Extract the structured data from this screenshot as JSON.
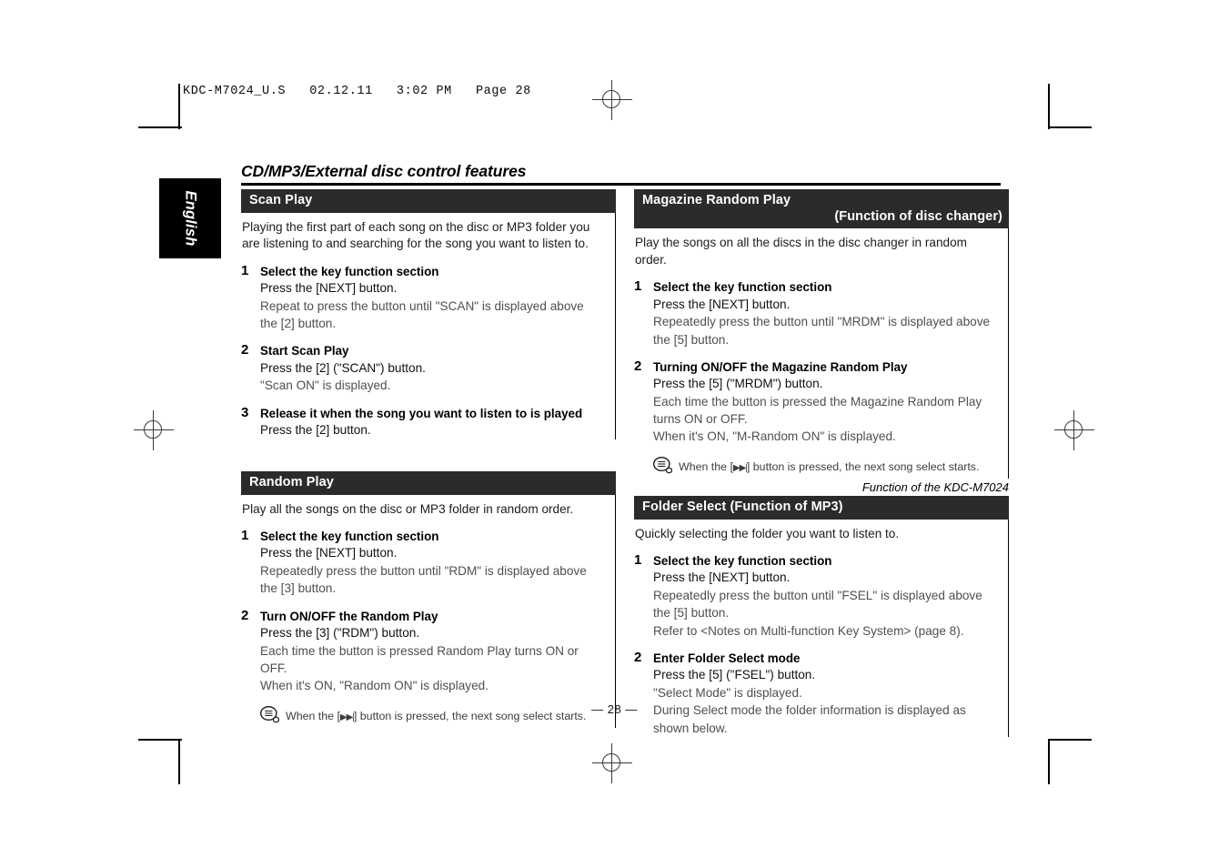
{
  "slug": "KDC-M7024_U.S   02.12.11   3:02 PM   Page 28",
  "language_tab": "English",
  "page_title": "CD/MP3/External disc control features",
  "page_number": "— 28 —",
  "caption_right": "Function of the KDC-M7024",
  "colors": {
    "header_bar": "#2b2b2b",
    "text_primary": "#111111",
    "text_secondary": "#4f4f4f",
    "rule": "#000000"
  },
  "sections": {
    "scan_play": {
      "title": "Scan Play",
      "intro": "Playing the first part of each song on the disc or MP3 folder you are listening to and searching for the song you want to listen to.",
      "steps": [
        {
          "num": "1",
          "title": "Select the key function section",
          "mid": "Press the [NEXT] button.",
          "lite": "Repeat to press the button until \"SCAN\" is displayed above the [2] button."
        },
        {
          "num": "2",
          "title": "Start Scan Play",
          "mid": "Press the [2] (\"SCAN\") button.",
          "lite": "\"Scan ON\" is displayed."
        },
        {
          "num": "3",
          "title": "Release it when the song you want to listen to is played",
          "mid": "Press the [2] button.",
          "lite": ""
        }
      ]
    },
    "magazine_random_play": {
      "title": "Magazine Random Play",
      "subtitle": "(Function of disc changer)",
      "intro": "Play the songs on all the discs in the disc changer in random order.",
      "steps": [
        {
          "num": "1",
          "title": "Select the key function section",
          "mid": "Press the [NEXT] button.",
          "lite": "Repeatedly press the button until \"MRDM\" is displayed above the [5] button."
        },
        {
          "num": "2",
          "title": "Turning ON/OFF the Magazine Random Play",
          "mid": "Press the [5] (\"MRDM\") button.",
          "lite": "Each time the button is pressed the Magazine Random Play turns ON or OFF.",
          "lite2": "When it's ON, \"M-Random ON\" is displayed."
        }
      ],
      "note_pre": "When the [",
      "note_post": "] button is pressed, the next song select starts."
    },
    "random_play": {
      "title": "Random Play",
      "intro": "Play all the songs on the disc or MP3 folder in random order.",
      "steps": [
        {
          "num": "1",
          "title": "Select the key function section",
          "mid": "Press the [NEXT] button.",
          "lite": "Repeatedly press the button until \"RDM\" is displayed above the [3] button."
        },
        {
          "num": "2",
          "title": "Turn ON/OFF the Random Play",
          "mid": "Press the [3] (\"RDM\") button.",
          "lite": "Each time the button is pressed Random Play turns ON or OFF.",
          "lite2": "When it's ON, \"Random ON\" is displayed."
        }
      ],
      "note_pre": "When the [",
      "note_post": "] button is pressed, the next song select starts."
    },
    "folder_select": {
      "title": "Folder Select (Function of MP3)",
      "intro": "Quickly selecting the folder you want to listen to.",
      "steps": [
        {
          "num": "1",
          "title": "Select the key function section",
          "mid": "Press the [NEXT] button.",
          "lite": "Repeatedly press the button until \"FSEL\" is displayed above the [5] button.",
          "lite2": "Refer to <Notes on Multi-function Key System> (page 8)."
        },
        {
          "num": "2",
          "title": "Enter Folder Select mode",
          "mid": "Press the [5] (\"FSEL\") button.",
          "lite": "\"Select Mode\" is displayed.",
          "lite2": "During Select mode the folder information is displayed as shown below."
        }
      ]
    }
  }
}
